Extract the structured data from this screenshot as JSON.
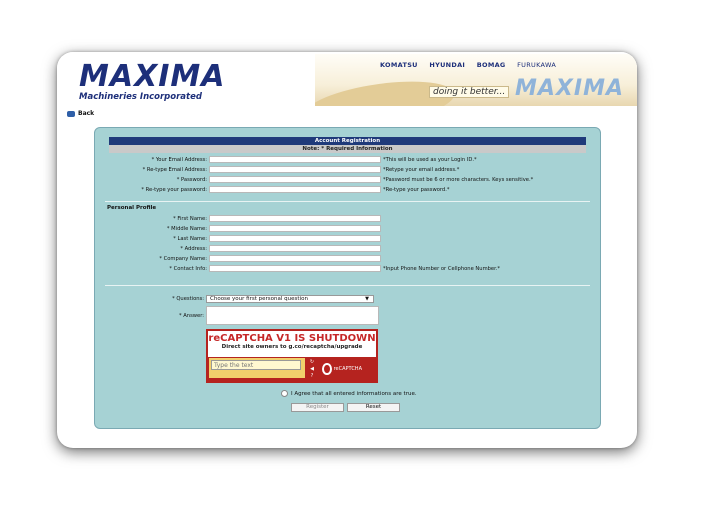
{
  "header": {
    "logo_main": "MAXIMA",
    "logo_sub": "Machineries Incorporated",
    "brands": [
      "KOMATSU",
      "HYUNDAI",
      "BOMAG",
      "FURUKAWA"
    ],
    "tagline": "doing it better...",
    "banner_logo": "MAXIMA"
  },
  "nav": {
    "back_label": "Back"
  },
  "form": {
    "title": "Account Registration",
    "note": "Note: * Required Information",
    "account_fields": [
      {
        "label": "* Your Email Address:",
        "hint": "*This will be used as your Login ID.*"
      },
      {
        "label": "* Re-type Email Address:",
        "hint": "*Retype your email address.*"
      },
      {
        "label": "* Password:",
        "hint": "*Password must be 6 or more characters. Keys sensitive.*"
      },
      {
        "label": "* Re-type your password:",
        "hint": "*Re-type your password.*"
      }
    ],
    "profile_section": "Personal Profile",
    "profile_fields": [
      {
        "label": "* First Name:",
        "hint": ""
      },
      {
        "label": "* Middle Name:",
        "hint": ""
      },
      {
        "label": "* Last Name:",
        "hint": ""
      },
      {
        "label": "* Address:",
        "hint": ""
      },
      {
        "label": "* Company Name:",
        "hint": ""
      },
      {
        "label": "* Contact Info:",
        "hint": "*Input Phone Number or Cellphone Number.*"
      }
    ],
    "question_label": "* Questions:",
    "question_selected": "Choose your first personal question",
    "answer_label": "* Answer:",
    "captcha": {
      "title": "reCAPTCHA V1 IS SHUTDOWN",
      "subtitle": "Direct site owners to g.co/recaptcha/upgrade",
      "input_placeholder": "Type the text",
      "logo_text": "reCAPTCHA"
    },
    "agree_label": "I Agree that all entered informations are true.",
    "register_label": "Register",
    "reset_label": "Reset"
  }
}
